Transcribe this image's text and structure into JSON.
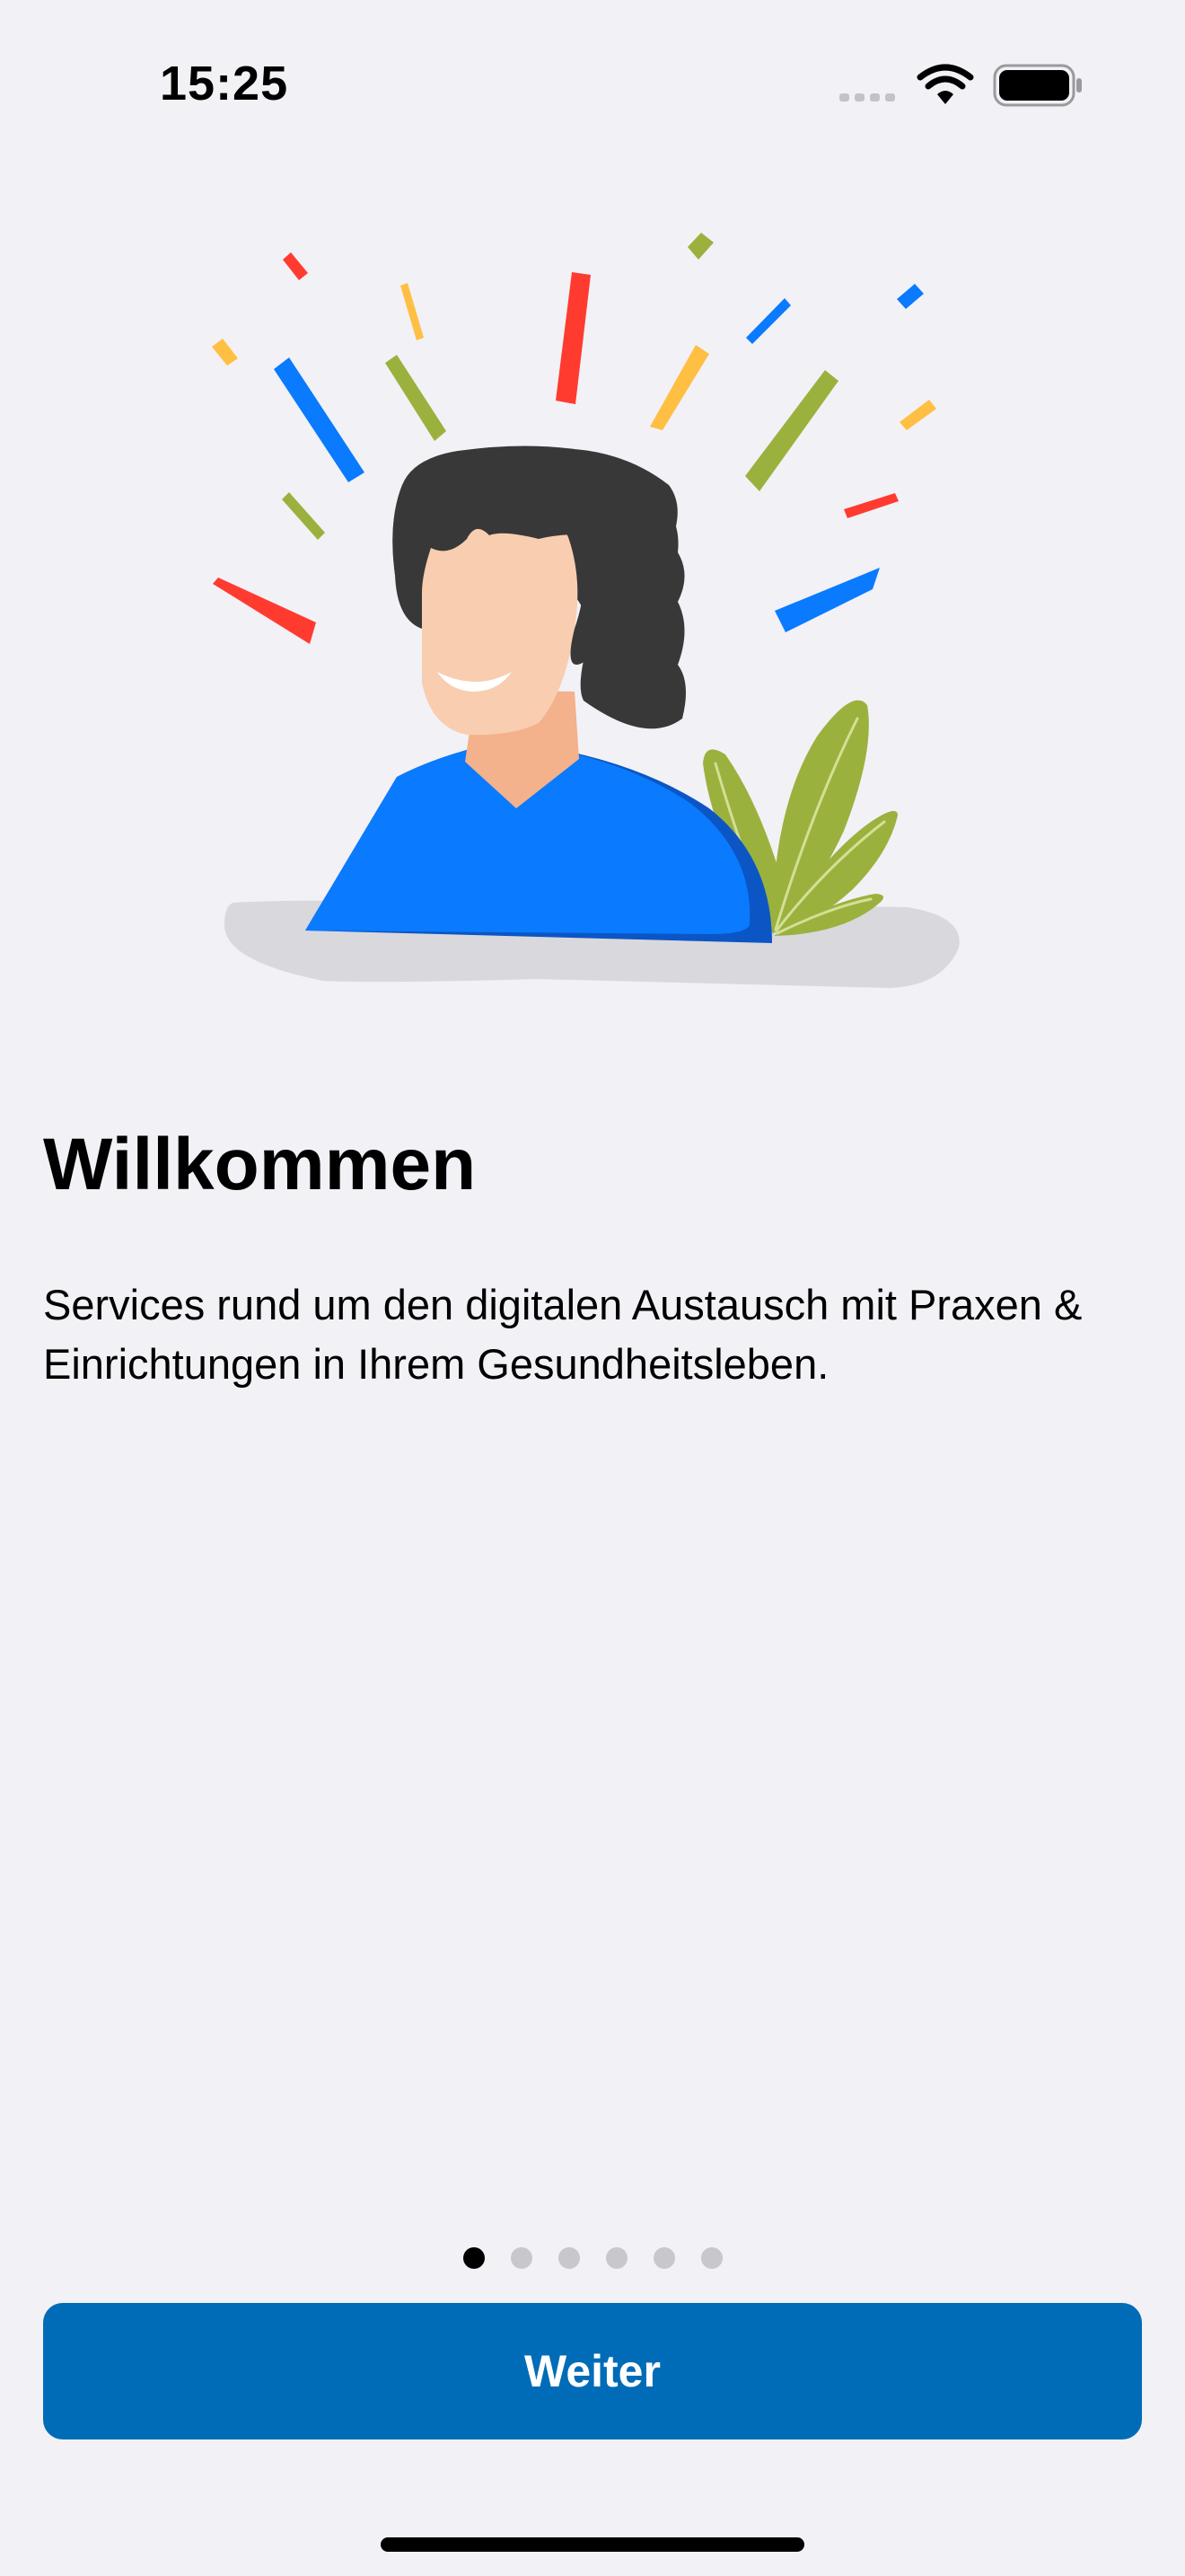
{
  "status_bar": {
    "time": "15:25",
    "icons": [
      "cellular-signal-icon",
      "wifi-icon",
      "battery-icon"
    ]
  },
  "illustration": {
    "subject": "welcome-person-illustration",
    "colors": {
      "blue": "#0a7aff",
      "red": "#ff3b30",
      "yellow": "#ffbf43",
      "green": "#9bb13e",
      "hair": "#383838",
      "skin": "#f9cdb0"
    }
  },
  "content": {
    "title": "Willkommen",
    "description": "Services rund um den digitalen Austausch mit Praxen & Einrichtungen in Ihrem Gesundheitsleben."
  },
  "pagination": {
    "total_pages": 6,
    "current_page": 1
  },
  "primary_button": {
    "label": "Weiter",
    "color": "#006cb7"
  }
}
